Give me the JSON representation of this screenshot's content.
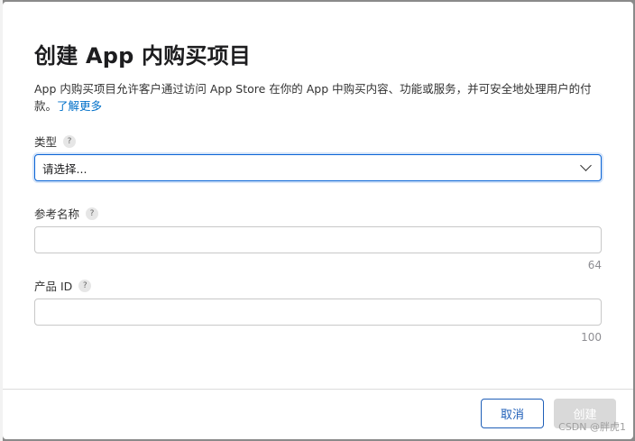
{
  "dialog": {
    "title": "创建 App 内购买项目",
    "description": "App 内购买项目允许客户通过访问 App Store 在你的 App 中购买内容、功能或服务，并可安全地处理用户的付款。",
    "learn_more": "了解更多"
  },
  "fields": {
    "type": {
      "label": "类型",
      "selected": "请选择..."
    },
    "reference_name": {
      "label": "参考名称",
      "value": "",
      "max_chars": "64"
    },
    "product_id": {
      "label": "产品 ID",
      "value": "",
      "max_chars": "100"
    }
  },
  "help_glyph": "?",
  "buttons": {
    "cancel": "取消",
    "create": "创建"
  },
  "watermark": "CSDN @胖虎1",
  "colors": {
    "accent": "#0a64d6",
    "link": "#0070c9",
    "disabled_button": "#d9d9d9"
  }
}
